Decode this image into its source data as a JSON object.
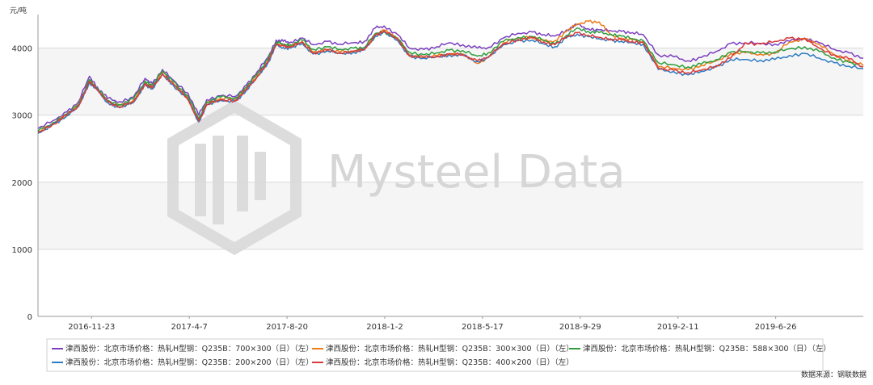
{
  "chart_data": {
    "type": "line",
    "unit_label": "元/吨",
    "source": "数据来源：钢联数据",
    "watermark": "Mysteel Data",
    "ylim": [
      0,
      4500
    ],
    "yticks": [
      0,
      1000,
      2000,
      3000,
      4000
    ],
    "grid": "horizontal",
    "shaded_bands": [
      [
        1000,
        2000
      ],
      [
        3000,
        4000
      ]
    ],
    "legend_position": "bottom",
    "xlim": [
      "2016-09-10",
      "2019-10-25"
    ],
    "xticks": [
      "2016-11-23",
      "2017-4-7",
      "2017-8-20",
      "2018-1-2",
      "2018-5-17",
      "2018-9-29",
      "2019-2-11",
      "2019-6-26"
    ],
    "x": [
      "2016-09-10",
      "2016-10-01",
      "2016-10-20",
      "2016-11-05",
      "2016-11-20",
      "2016-12-01",
      "2016-12-15",
      "2017-01-01",
      "2017-01-20",
      "2017-02-05",
      "2017-02-15",
      "2017-03-01",
      "2017-03-15",
      "2017-04-05",
      "2017-04-20",
      "2017-05-01",
      "2017-05-20",
      "2017-06-10",
      "2017-06-25",
      "2017-07-10",
      "2017-07-25",
      "2017-08-05",
      "2017-08-15",
      "2017-08-25",
      "2017-09-10",
      "2017-09-25",
      "2017-10-15",
      "2017-11-01",
      "2017-11-20",
      "2017-12-05",
      "2017-12-20",
      "2018-01-01",
      "2018-01-20",
      "2018-02-05",
      "2018-02-25",
      "2018-03-15",
      "2018-04-01",
      "2018-04-20",
      "2018-05-10",
      "2018-05-25",
      "2018-06-15",
      "2018-07-05",
      "2018-07-25",
      "2018-08-10",
      "2018-08-25",
      "2018-09-10",
      "2018-09-25",
      "2018-10-10",
      "2018-10-25",
      "2018-11-10",
      "2018-11-25",
      "2018-12-10",
      "2018-12-25",
      "2019-01-15",
      "2019-02-05",
      "2019-02-25",
      "2019-03-15",
      "2019-04-05",
      "2019-04-25",
      "2019-05-15",
      "2019-06-05",
      "2019-06-25",
      "2019-07-15",
      "2019-08-05",
      "2019-08-25",
      "2019-09-15",
      "2019-10-05",
      "2019-10-25"
    ],
    "series": [
      {
        "name": "津西股份：北京市场价格：热轧H型钢：Q235B：700×300（日）（左）",
        "color": "#7b3fbf",
        "values": [
          2800,
          2920,
          3050,
          3200,
          3580,
          3420,
          3250,
          3200,
          3270,
          3550,
          3470,
          3680,
          3530,
          3330,
          3000,
          3230,
          3290,
          3280,
          3450,
          3650,
          3870,
          4120,
          4100,
          4090,
          4150,
          4050,
          4100,
          4060,
          4080,
          4100,
          4300,
          4330,
          4200,
          4000,
          3980,
          4020,
          4080,
          4050,
          4000,
          4010,
          4150,
          4220,
          4240,
          4200,
          4180,
          4270,
          4350,
          4290,
          4270,
          4260,
          4250,
          4230,
          4200,
          3900,
          3870,
          3810,
          3860,
          3950,
          4070,
          4080,
          4070,
          4060,
          4100,
          4150,
          4080,
          3980,
          3930,
          3850
        ]
      },
      {
        "name": "津西股份：北京市场价格：热轧H型钢：Q235B：300×300（日）（左）",
        "color": "#ef7a1a",
        "values": [
          2750,
          2880,
          3010,
          3150,
          3520,
          3390,
          3210,
          3140,
          3220,
          3490,
          3420,
          3640,
          3490,
          3260,
          2930,
          3180,
          3250,
          3240,
          3400,
          3600,
          3820,
          4070,
          4040,
          4030,
          4100,
          3940,
          3980,
          3940,
          3960,
          4000,
          4200,
          4270,
          4150,
          3900,
          3870,
          3880,
          3920,
          3910,
          3770,
          3860,
          4080,
          4150,
          4170,
          4100,
          4110,
          4250,
          4360,
          4400,
          4390,
          4200,
          4150,
          4120,
          4100,
          3720,
          3700,
          3680,
          3740,
          3810,
          3920,
          3930,
          3910,
          3920,
          4090,
          4140,
          4060,
          3900,
          3820,
          3740
        ]
      },
      {
        "name": "津西股份：北京市场价格：热轧H型钢：Q235B：588×300（日）（左）",
        "color": "#2e9e3f",
        "values": [
          2760,
          2890,
          3020,
          3160,
          3530,
          3400,
          3220,
          3160,
          3240,
          3510,
          3440,
          3660,
          3510,
          3290,
          2950,
          3200,
          3270,
          3260,
          3420,
          3620,
          3840,
          4090,
          4060,
          4050,
          4120,
          3980,
          4020,
          3980,
          4000,
          4010,
          4220,
          4250,
          4130,
          3940,
          3900,
          3930,
          3970,
          3960,
          3880,
          3930,
          4100,
          4160,
          4170,
          4120,
          4060,
          4190,
          4300,
          4250,
          4230,
          4210,
          4180,
          4140,
          4110,
          3780,
          3750,
          3720,
          3760,
          3830,
          3940,
          3950,
          3930,
          3940,
          3990,
          4020,
          3950,
          3850,
          3790,
          3720
        ]
      },
      {
        "name": "津西股份：北京市场价格：热轧H型钢：Q235B：200×200（日）（左）",
        "color": "#2d7bc4",
        "values": [
          2730,
          2860,
          2990,
          3130,
          3490,
          3370,
          3190,
          3110,
          3190,
          3460,
          3390,
          3610,
          3460,
          3230,
          2900,
          3150,
          3220,
          3210,
          3370,
          3570,
          3790,
          4040,
          4010,
          4000,
          4070,
          3910,
          3960,
          3920,
          3940,
          3970,
          4180,
          4240,
          4110,
          3880,
          3850,
          3870,
          3900,
          3890,
          3800,
          3860,
          4050,
          4110,
          4120,
          4060,
          4020,
          4150,
          4210,
          4170,
          4140,
          4120,
          4100,
          4080,
          4060,
          3680,
          3650,
          3600,
          3650,
          3720,
          3830,
          3830,
          3820,
          3830,
          3890,
          3920,
          3850,
          3780,
          3730,
          3690
        ]
      },
      {
        "name": "津西股份：北京市场价格：热轧H型钢：Q235B：400×200（日）（左）",
        "color": "#d93a3a",
        "values": [
          2740,
          2870,
          3000,
          3140,
          3500,
          3380,
          3200,
          3120,
          3200,
          3470,
          3400,
          3620,
          3470,
          3240,
          2910,
          3160,
          3230,
          3220,
          3380,
          3580,
          3800,
          4060,
          4030,
          4020,
          4090,
          3930,
          3970,
          3930,
          3950,
          3980,
          4190,
          4260,
          4130,
          3890,
          3860,
          3880,
          3910,
          3900,
          3810,
          3870,
          4060,
          4130,
          4150,
          4090,
          4050,
          4170,
          4230,
          4190,
          4160,
          4140,
          4120,
          4100,
          4080,
          3700,
          3670,
          3630,
          3670,
          3740,
          3850,
          4080,
          4060,
          4100,
          4150,
          4140,
          4000,
          3900,
          3840,
          3720
        ]
      }
    ]
  }
}
